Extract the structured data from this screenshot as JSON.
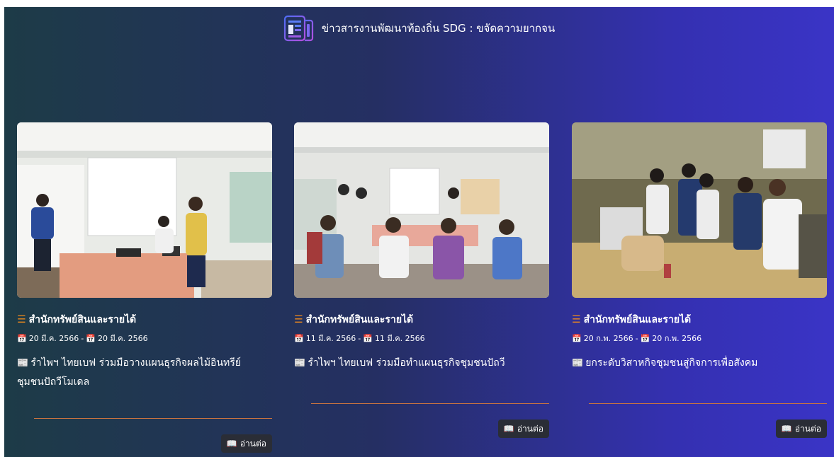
{
  "header": {
    "title": "ข่าวสารงานพัฒนาท้องถิ่น  SDG : ขจัดความยากจน",
    "icon": "newspaper-icon"
  },
  "colors": {
    "accent_orange": "#f08a1c",
    "divider": "#c87340",
    "button_bg": "#2a2d36"
  },
  "cards": [
    {
      "department": "สำนักทรัพย์สินและรายได้",
      "date_start": "20 มี.ค. 2566",
      "date_end": "20 มี.ค. 2566",
      "title": "รำไพฯ ไทยเบฟ ร่วมมือวางแผนธุรกิจผลไม้อินทรีย์ชุมชนปัถวีโมเดล",
      "read_more": "อ่านต่อ"
    },
    {
      "department": "สำนักทรัพย์สินและรายได้",
      "date_start": "11 มี.ค. 2566",
      "date_end": "11 มี.ค. 2566",
      "title": "รำไพฯ ไทยเบฟ ร่วมมือทำแผนธุรกิจชุมชนปัถวี",
      "read_more": "อ่านต่อ"
    },
    {
      "department": "สำนักทรัพย์สินและรายได้",
      "date_start": "20 ก.พ. 2566",
      "date_end": "20 ก.พ. 2566",
      "title": "ยกระดับวิสาหกิจชุมชนสู่กิจการเพื่อสังคม",
      "read_more": "อ่านต่อ"
    }
  ]
}
